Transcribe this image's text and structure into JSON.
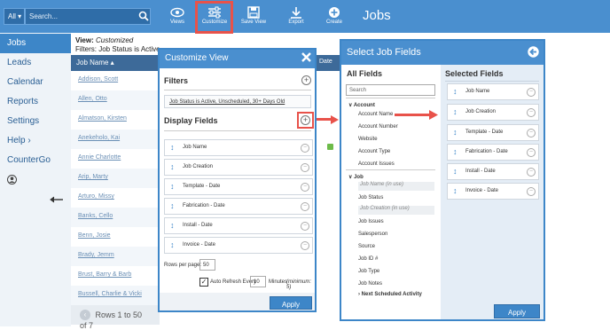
{
  "topbar": {
    "all_label": "All ▾",
    "search_placeholder": "Search...",
    "tools": [
      {
        "label": "Views",
        "icon": "eye-icon"
      },
      {
        "label": "Customize",
        "icon": "sliders-icon"
      },
      {
        "label": "Save View",
        "icon": "save-icon"
      },
      {
        "label": "Export",
        "icon": "download-icon"
      },
      {
        "label": "Create",
        "icon": "plus-circle-icon"
      }
    ],
    "page_title": "Jobs"
  },
  "sidebar": {
    "items": [
      {
        "label": "Jobs"
      },
      {
        "label": "Leads"
      },
      {
        "label": "Calendar"
      },
      {
        "label": "Reports"
      },
      {
        "label": "Settings"
      },
      {
        "label": "Help ›"
      },
      {
        "label": "CounterGo"
      }
    ]
  },
  "content": {
    "view_label": "View:",
    "view_value": "Customized",
    "filters_label": "Filters:",
    "filters_value": "Job Status is Active",
    "column_header": "Job Name ▴",
    "date_header": "Date",
    "rows": [
      "Addison, Scott",
      "Allen, Otto",
      "Almatson, Kirsten",
      "Anekeholo, Kai",
      "Annie Charlotte",
      "Arip, Marty",
      "Arturo, Missy",
      "Banks, Cello",
      "Benn, Josie",
      "Brady, Jemm",
      "Brust, Barry & Barb",
      "Bussell, Charlie & Vicki"
    ],
    "paging_text": "Rows 1 to 50 of 7"
  },
  "customize_dialog": {
    "title": "Customize View",
    "filters_title": "Filters",
    "filter_value": "Job Status is Active, Unscheduled, 30+ Days Old",
    "display_fields_title": "Display Fields",
    "fields": [
      "Job Name",
      "Job Creation",
      "Template - Date",
      "Fabrication - Date",
      "Install - Date",
      "Invoice - Date"
    ],
    "rows_per_page_label": "Rows per page:",
    "rows_per_page_value": "50",
    "auto_refresh_label": "Auto Refresh Every",
    "auto_refresh_value": "10",
    "minutes_label": "Minutes",
    "minimum_label": "(minimum: 5)",
    "apply_label": "Apply"
  },
  "select_dialog": {
    "title": "Select Job Fields",
    "all_fields_title": "All Fields",
    "search_placeholder": "Search",
    "groups": [
      {
        "name": "Account",
        "items": [
          {
            "label": "Account Name",
            "used": false
          },
          {
            "label": "Account Number",
            "used": false
          },
          {
            "label": "Website",
            "used": false
          },
          {
            "label": "Account Type",
            "used": false
          },
          {
            "label": "Account Issues",
            "used": false
          }
        ]
      },
      {
        "name": "Job",
        "items": [
          {
            "label": "Job Name (in use)",
            "used": true
          },
          {
            "label": "Job Status",
            "used": false
          },
          {
            "label": "Job Creation (in use)",
            "used": true
          },
          {
            "label": "Job Issues",
            "used": false
          },
          {
            "label": "Salesperson",
            "used": false
          },
          {
            "label": "Source",
            "used": false
          },
          {
            "label": "Job ID #",
            "used": false
          },
          {
            "label": "Job Type",
            "used": false
          },
          {
            "label": "Job Notes",
            "used": false
          }
        ]
      }
    ],
    "next_group": "Next Scheduled Activity",
    "selected_fields_title": "Selected Fields",
    "selected": [
      "Job Name",
      "Job Creation",
      "Template - Date",
      "Fabrication - Date",
      "Install - Date",
      "Invoice - Date"
    ],
    "apply_label": "Apply"
  },
  "colors": {
    "accent": "#4a8fcf",
    "highlight": "#e8524a"
  }
}
